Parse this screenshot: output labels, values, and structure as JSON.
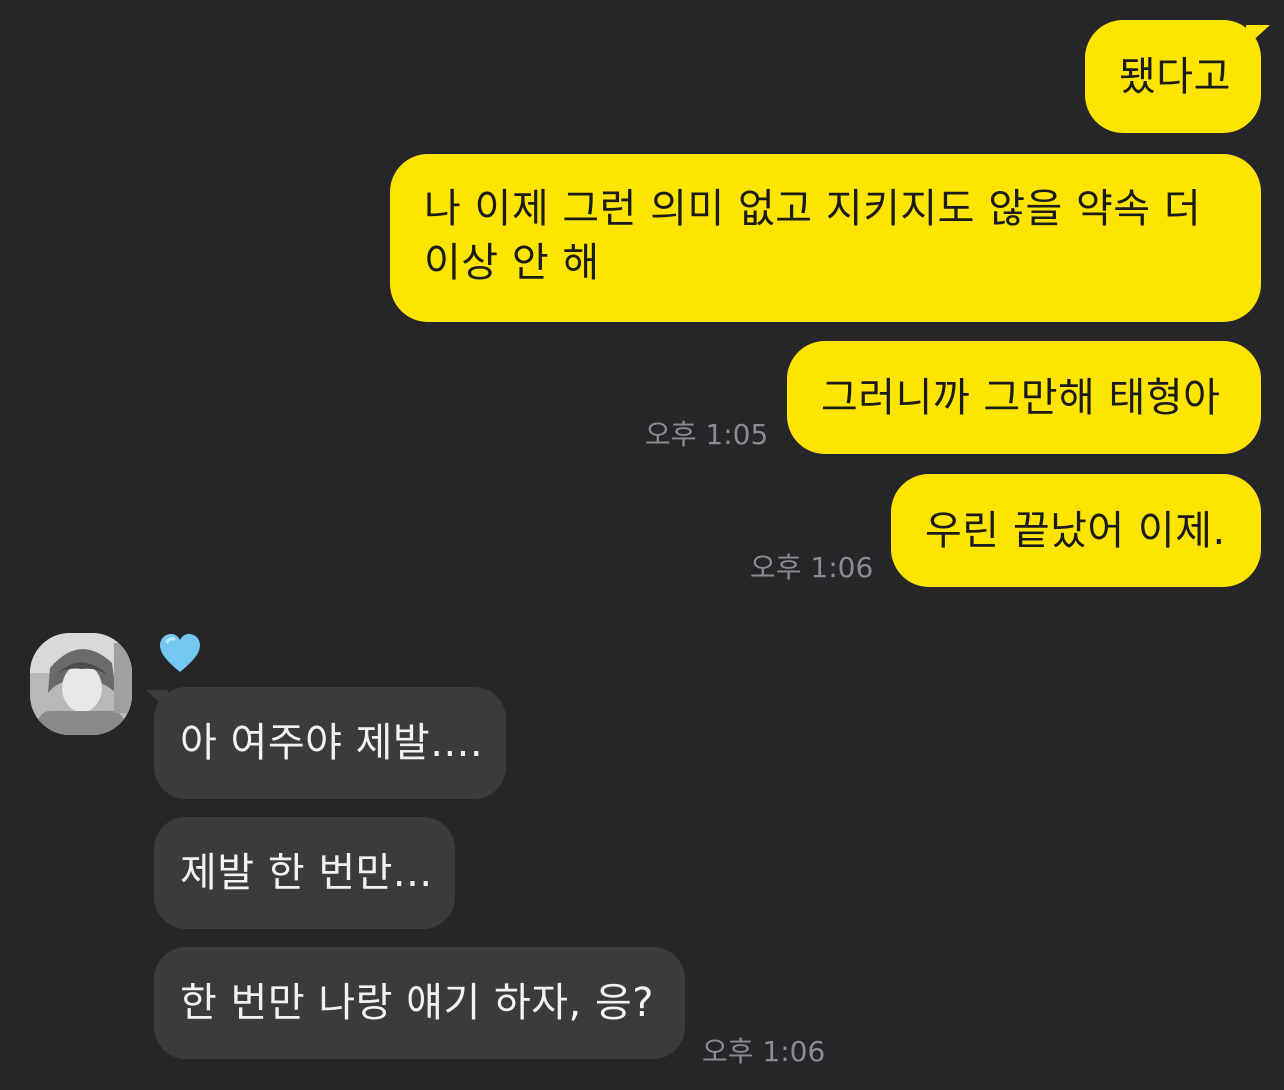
{
  "conversation": {
    "sent": [
      {
        "text": "됐다고"
      },
      {
        "text": "나 이제 그런 의미 없고 지키지도 않을 약속 더 이상 안 해"
      },
      {
        "text": "그러니까 그만해 태형아",
        "time": "오후 1:05"
      },
      {
        "text": "우린 끝났어 이제.",
        "time": "오후 1:06"
      }
    ],
    "sender": {
      "name_icon": "blue-heart-emoji",
      "avatar": "profile-photo-grayscale"
    },
    "received": [
      {
        "text": "아 여주야 제발...."
      },
      {
        "text": "제발 한 번만..."
      },
      {
        "text": "한 번만 나랑 얘기 하자, 응?",
        "time": "오후 1:06"
      }
    ]
  },
  "colors": {
    "background": "#262629",
    "sent_bubble": "#FEE500",
    "received_bubble": "#3b3b3e",
    "heart": "#74C7F1"
  }
}
